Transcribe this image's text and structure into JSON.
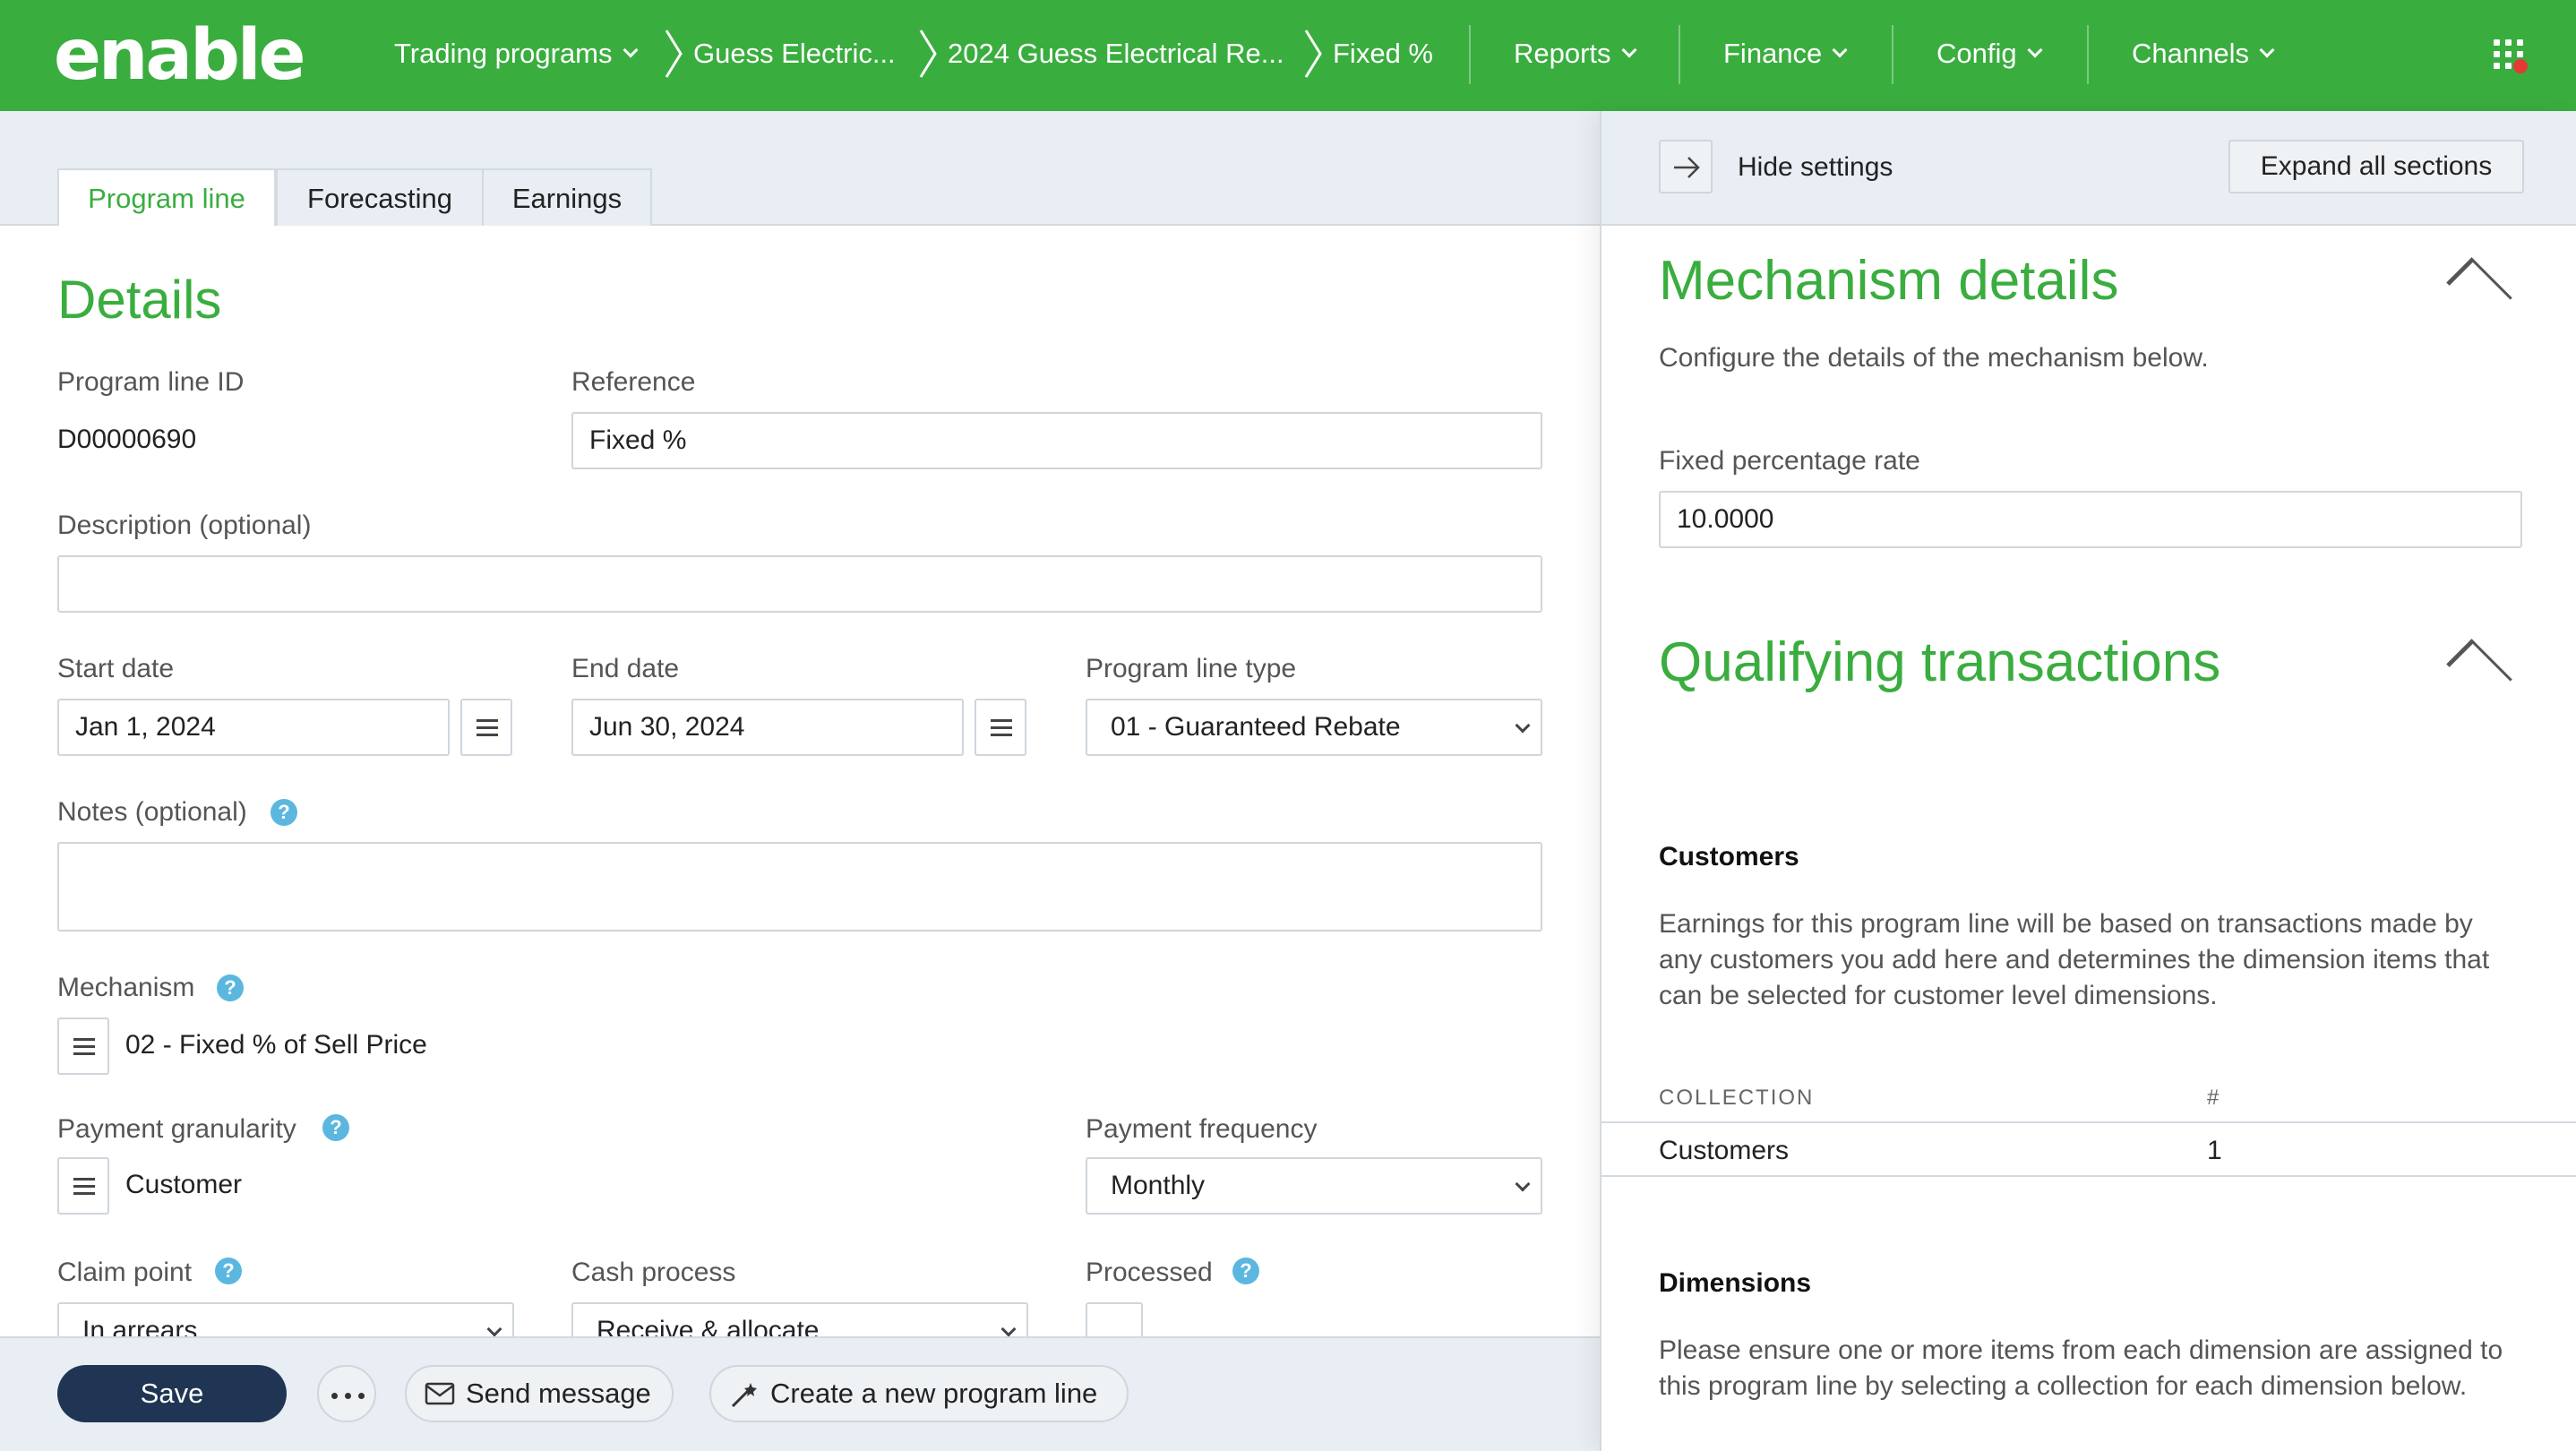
{
  "app": {
    "logo": "enable"
  },
  "nav": {
    "trading_programs": "Trading programs",
    "crumb_1": "Guess Electric...",
    "crumb_2": "2024 Guess Electrical Re...",
    "crumb_3": "Fixed %",
    "reports": "Reports",
    "finance": "Finance",
    "config": "Config",
    "channels": "Channels"
  },
  "tabs": [
    {
      "label": "Program line",
      "active": true
    },
    {
      "label": "Forecasting",
      "active": false
    },
    {
      "label": "Earnings",
      "active": false
    }
  ],
  "details": {
    "heading": "Details",
    "program_line_id_label": "Program line ID",
    "program_line_id": "D00000690",
    "reference_label": "Reference",
    "reference_value": "Fixed %",
    "description_label": "Description (optional)",
    "description_value": "",
    "start_date_label": "Start date",
    "start_date": "Jan 1, 2024",
    "end_date_label": "End date",
    "end_date": "Jun 30, 2024",
    "program_line_type_label": "Program line type",
    "program_line_type": "01 - Guaranteed Rebate",
    "notes_label": "Notes (optional)",
    "notes_value": "",
    "mechanism_label": "Mechanism",
    "mechanism_value": "02 - Fixed % of Sell Price",
    "payment_granularity_label": "Payment granularity",
    "payment_granularity_value": "Customer",
    "payment_frequency_label": "Payment frequency",
    "payment_frequency": "Monthly",
    "claim_point_label": "Claim point",
    "claim_point": "In arrears",
    "cash_process_label": "Cash process",
    "cash_process": "Receive & allocate",
    "processed_label": "Processed",
    "processed_checked": false
  },
  "actions": {
    "save": "Save",
    "send_message": "Send message",
    "create_new": "Create a new program line"
  },
  "settings": {
    "hide_label": "Hide settings",
    "expand_label": "Expand all sections",
    "mechanism_heading": "Mechanism details",
    "mechanism_desc": "Configure the details of the mechanism below.",
    "fixed_rate_label": "Fixed percentage rate",
    "fixed_rate_value": "10.0000",
    "qualifying_heading": "Qualifying transactions",
    "customers_heading": "Customers",
    "customers_desc": "Earnings for this program line will be based on transactions made by any customers you add here and determines the dimension items that can be selected for customer level dimensions.",
    "collection_col": "COLLECTION",
    "count_col": "#",
    "collection_rows": [
      {
        "name": "Customers",
        "count": "1"
      }
    ],
    "dimensions_heading": "Dimensions",
    "dimensions_desc": "Please ensure one or more items from each dimension are assigned to this program line by selecting a collection for each dimension below."
  },
  "colors": {
    "brand_green": "#3aad3f",
    "navy": "#1f3553",
    "help_blue": "#5bb7e0",
    "alert_red": "#e53935"
  }
}
